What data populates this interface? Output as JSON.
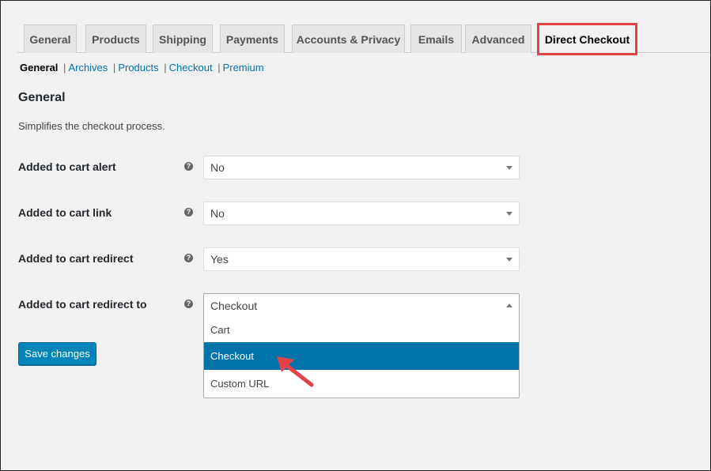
{
  "tabs": [
    {
      "label": "General"
    },
    {
      "label": "Products"
    },
    {
      "label": "Shipping"
    },
    {
      "label": "Payments"
    },
    {
      "label": "Accounts & Privacy"
    },
    {
      "label": "Emails"
    },
    {
      "label": "Advanced"
    },
    {
      "label": "Direct Checkout",
      "active": true
    }
  ],
  "subnav": {
    "current": "General",
    "links": [
      "Archives",
      "Products",
      "Checkout",
      "Premium"
    ],
    "separator": "|"
  },
  "section": {
    "title": "General",
    "description": "Simplifies the checkout process."
  },
  "settings": [
    {
      "label": "Added to cart alert",
      "value": "No"
    },
    {
      "label": "Added to cart link",
      "value": "No"
    },
    {
      "label": "Added to cart redirect",
      "value": "Yes"
    },
    {
      "label": "Added to cart redirect to",
      "value": "Checkout",
      "open": true
    }
  ],
  "help_glyph": "?",
  "dropdown_options": [
    "Cart",
    "Checkout",
    "Custom URL"
  ],
  "highlighted_option": "Checkout",
  "save_label": "Save changes",
  "colors": {
    "accent": "#0073aa",
    "button": "#0085ba",
    "highlight_box": "#e34346",
    "annotation_arrow": "#e34346"
  }
}
